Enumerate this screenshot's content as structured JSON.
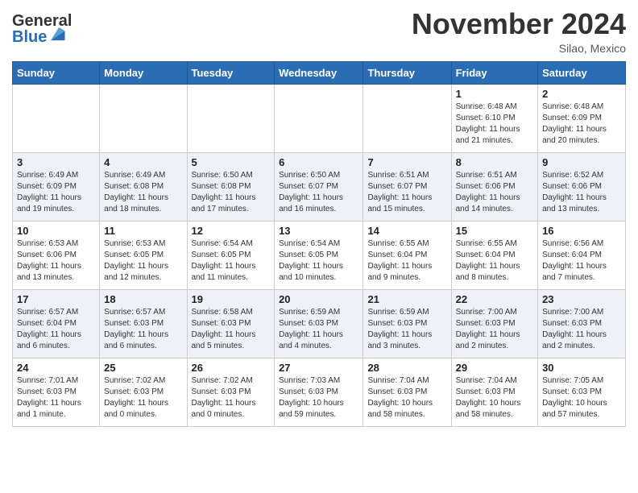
{
  "header": {
    "logo_general": "General",
    "logo_blue": "Blue",
    "month_title": "November 2024",
    "location": "Silao, Mexico"
  },
  "calendar": {
    "days_of_week": [
      "Sunday",
      "Monday",
      "Tuesday",
      "Wednesday",
      "Thursday",
      "Friday",
      "Saturday"
    ],
    "weeks": [
      [
        {
          "day": "",
          "info": ""
        },
        {
          "day": "",
          "info": ""
        },
        {
          "day": "",
          "info": ""
        },
        {
          "day": "",
          "info": ""
        },
        {
          "day": "",
          "info": ""
        },
        {
          "day": "1",
          "info": "Sunrise: 6:48 AM\nSunset: 6:10 PM\nDaylight: 11 hours\nand 21 minutes."
        },
        {
          "day": "2",
          "info": "Sunrise: 6:48 AM\nSunset: 6:09 PM\nDaylight: 11 hours\nand 20 minutes."
        }
      ],
      [
        {
          "day": "3",
          "info": "Sunrise: 6:49 AM\nSunset: 6:09 PM\nDaylight: 11 hours\nand 19 minutes."
        },
        {
          "day": "4",
          "info": "Sunrise: 6:49 AM\nSunset: 6:08 PM\nDaylight: 11 hours\nand 18 minutes."
        },
        {
          "day": "5",
          "info": "Sunrise: 6:50 AM\nSunset: 6:08 PM\nDaylight: 11 hours\nand 17 minutes."
        },
        {
          "day": "6",
          "info": "Sunrise: 6:50 AM\nSunset: 6:07 PM\nDaylight: 11 hours\nand 16 minutes."
        },
        {
          "day": "7",
          "info": "Sunrise: 6:51 AM\nSunset: 6:07 PM\nDaylight: 11 hours\nand 15 minutes."
        },
        {
          "day": "8",
          "info": "Sunrise: 6:51 AM\nSunset: 6:06 PM\nDaylight: 11 hours\nand 14 minutes."
        },
        {
          "day": "9",
          "info": "Sunrise: 6:52 AM\nSunset: 6:06 PM\nDaylight: 11 hours\nand 13 minutes."
        }
      ],
      [
        {
          "day": "10",
          "info": "Sunrise: 6:53 AM\nSunset: 6:06 PM\nDaylight: 11 hours\nand 13 minutes."
        },
        {
          "day": "11",
          "info": "Sunrise: 6:53 AM\nSunset: 6:05 PM\nDaylight: 11 hours\nand 12 minutes."
        },
        {
          "day": "12",
          "info": "Sunrise: 6:54 AM\nSunset: 6:05 PM\nDaylight: 11 hours\nand 11 minutes."
        },
        {
          "day": "13",
          "info": "Sunrise: 6:54 AM\nSunset: 6:05 PM\nDaylight: 11 hours\nand 10 minutes."
        },
        {
          "day": "14",
          "info": "Sunrise: 6:55 AM\nSunset: 6:04 PM\nDaylight: 11 hours\nand 9 minutes."
        },
        {
          "day": "15",
          "info": "Sunrise: 6:55 AM\nSunset: 6:04 PM\nDaylight: 11 hours\nand 8 minutes."
        },
        {
          "day": "16",
          "info": "Sunrise: 6:56 AM\nSunset: 6:04 PM\nDaylight: 11 hours\nand 7 minutes."
        }
      ],
      [
        {
          "day": "17",
          "info": "Sunrise: 6:57 AM\nSunset: 6:04 PM\nDaylight: 11 hours\nand 6 minutes."
        },
        {
          "day": "18",
          "info": "Sunrise: 6:57 AM\nSunset: 6:03 PM\nDaylight: 11 hours\nand 6 minutes."
        },
        {
          "day": "19",
          "info": "Sunrise: 6:58 AM\nSunset: 6:03 PM\nDaylight: 11 hours\nand 5 minutes."
        },
        {
          "day": "20",
          "info": "Sunrise: 6:59 AM\nSunset: 6:03 PM\nDaylight: 11 hours\nand 4 minutes."
        },
        {
          "day": "21",
          "info": "Sunrise: 6:59 AM\nSunset: 6:03 PM\nDaylight: 11 hours\nand 3 minutes."
        },
        {
          "day": "22",
          "info": "Sunrise: 7:00 AM\nSunset: 6:03 PM\nDaylight: 11 hours\nand 2 minutes."
        },
        {
          "day": "23",
          "info": "Sunrise: 7:00 AM\nSunset: 6:03 PM\nDaylight: 11 hours\nand 2 minutes."
        }
      ],
      [
        {
          "day": "24",
          "info": "Sunrise: 7:01 AM\nSunset: 6:03 PM\nDaylight: 11 hours\nand 1 minute."
        },
        {
          "day": "25",
          "info": "Sunrise: 7:02 AM\nSunset: 6:03 PM\nDaylight: 11 hours\nand 0 minutes."
        },
        {
          "day": "26",
          "info": "Sunrise: 7:02 AM\nSunset: 6:03 PM\nDaylight: 11 hours\nand 0 minutes."
        },
        {
          "day": "27",
          "info": "Sunrise: 7:03 AM\nSunset: 6:03 PM\nDaylight: 10 hours\nand 59 minutes."
        },
        {
          "day": "28",
          "info": "Sunrise: 7:04 AM\nSunset: 6:03 PM\nDaylight: 10 hours\nand 58 minutes."
        },
        {
          "day": "29",
          "info": "Sunrise: 7:04 AM\nSunset: 6:03 PM\nDaylight: 10 hours\nand 58 minutes."
        },
        {
          "day": "30",
          "info": "Sunrise: 7:05 AM\nSunset: 6:03 PM\nDaylight: 10 hours\nand 57 minutes."
        }
      ]
    ]
  }
}
